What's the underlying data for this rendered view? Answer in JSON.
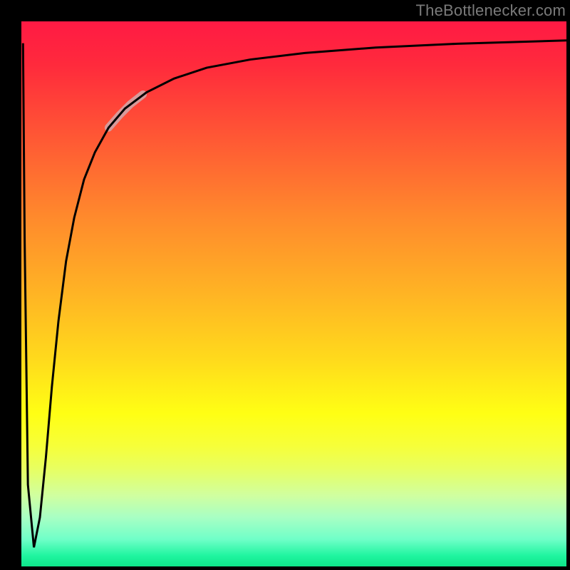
{
  "watermark": "TheBottlenecker.com",
  "chart_data": {
    "type": "line",
    "title": "",
    "xlabel": "",
    "ylabel": "",
    "xlim": [
      0,
      100
    ],
    "ylim": [
      0,
      100
    ],
    "background_gradient": {
      "top": "#ff1a44",
      "middle": "#ffff14",
      "bottom": "#0ee68a"
    },
    "series": [
      {
        "name": "curve",
        "stroke": "#000000",
        "stroke_width": 3,
        "x": [
          0.3,
          0.6,
          1.2,
          2.3,
          3.4,
          4.5,
          5.6,
          6.8,
          8.2,
          9.7,
          11.5,
          13.5,
          16.0,
          19.0,
          23.0,
          28.0,
          34.0,
          42.0,
          52.0,
          65.0,
          80.0,
          100.0
        ],
        "y": [
          96.0,
          60.0,
          15.0,
          3.5,
          9.0,
          20.0,
          33.0,
          45.0,
          56.0,
          64.0,
          71.0,
          76.0,
          80.5,
          84.0,
          87.0,
          89.5,
          91.5,
          93.0,
          94.2,
          95.2,
          95.9,
          96.5
        ]
      },
      {
        "name": "highlight",
        "stroke": "#d79a9a",
        "stroke_width": 11,
        "x": [
          16.0,
          18.0,
          20.0,
          22.3
        ],
        "y": [
          80.5,
          82.8,
          84.8,
          86.6
        ]
      }
    ],
    "annotations": []
  }
}
